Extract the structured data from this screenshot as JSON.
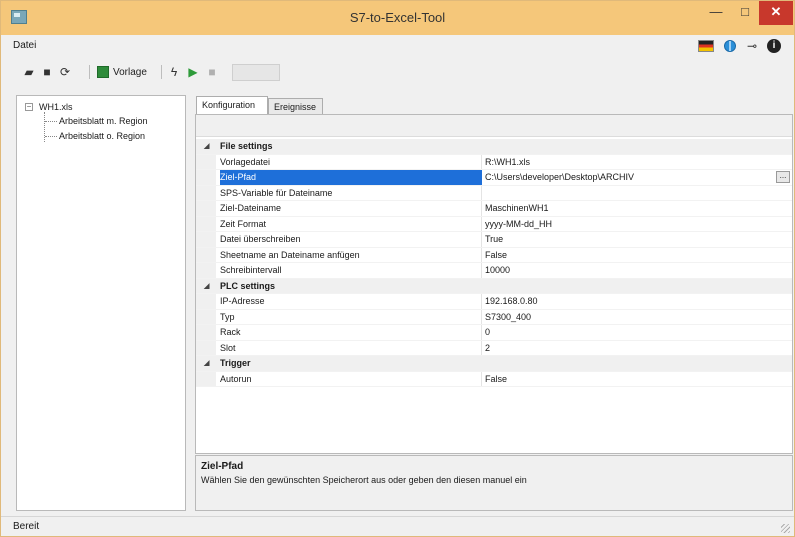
{
  "window": {
    "title": "S7-to-Excel-Tool",
    "minimize": "—",
    "maximize": "□",
    "close": "✕"
  },
  "menu": {
    "datei": "Datei"
  },
  "toolbar": {
    "vorlage_label": "Vorlage"
  },
  "tree": {
    "root": "WH1.xls",
    "children": [
      "Arbeitsblatt m. Region",
      "Arbeitsblatt o. Region"
    ]
  },
  "tabs": [
    "Konfiguration",
    "Ereignisse"
  ],
  "properties": {
    "file_settings": {
      "title": "File settings",
      "rows": [
        {
          "name": "Vorlagedatei",
          "value": "R:\\WH1.xls"
        },
        {
          "name": "Ziel-Pfad",
          "value": "C:\\Users\\developer\\Desktop\\ARCHIV"
        },
        {
          "name": "SPS-Variable für Dateiname",
          "value": ""
        },
        {
          "name": "Ziel-Dateiname",
          "value": "MaschinenWH1"
        },
        {
          "name": "Zeit Format",
          "value": "yyyy-MM-dd_HH"
        },
        {
          "name": "Datei überschreiben",
          "value": "True"
        },
        {
          "name": "Sheetname an Dateiname anfügen",
          "value": "False"
        },
        {
          "name": "Schreibintervall",
          "value": "10000"
        }
      ]
    },
    "plc_settings": {
      "title": "PLC settings",
      "rows": [
        {
          "name": "IP-Adresse",
          "value": "192.168.0.80"
        },
        {
          "name": "Typ",
          "value": "S7300_400"
        },
        {
          "name": "Rack",
          "value": "0"
        },
        {
          "name": "Slot",
          "value": "2"
        }
      ]
    },
    "trigger": {
      "title": "Trigger",
      "rows": [
        {
          "name": "Autorun",
          "value": "False"
        }
      ]
    },
    "ellipsis": "..."
  },
  "description": {
    "title": "Ziel-Pfad",
    "text": "Wählen Sie den gewünschten Speicherort aus oder geben den diesen manuel ein"
  },
  "status": {
    "text": "Bereit"
  },
  "icons": {
    "chevron": "◢",
    "tree_toggle": "−",
    "key": "⊸",
    "info": "i"
  },
  "colors": {
    "titlebar": "#f5c77a",
    "close": "#c8382c",
    "selection": "#1e6fd9"
  }
}
